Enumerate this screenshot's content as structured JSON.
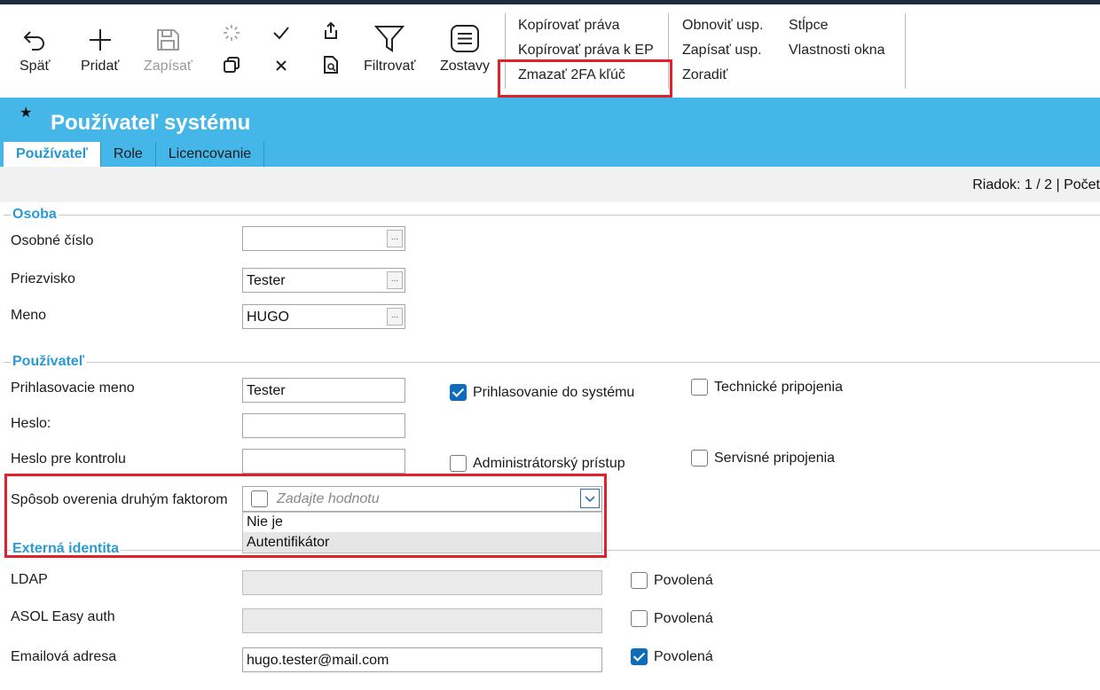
{
  "toolbar": {
    "back_label": "Späť",
    "add_label": "Pridať",
    "save_label": "Zapísať",
    "filter_label": "Filtrovať",
    "reports_label": "Zostavy",
    "menu_col1": [
      "Kopírovať práva",
      "Kopírovať práva k EP",
      "Zmazať 2FA kľúč"
    ],
    "menu_col2": [
      "Obnoviť usp.",
      "Zapísať usp.",
      "Zoradiť"
    ],
    "menu_col3": [
      "Stĺpce",
      "Vlastnosti okna"
    ]
  },
  "page": {
    "title": "Používateľ systému",
    "tabs": [
      "Používateľ",
      "Role",
      "Licencovanie"
    ],
    "status": "Riadok: 1 / 2 | Počet"
  },
  "osoba": {
    "title": "Osoba",
    "personal_number_label": "Osobné číslo",
    "personal_number_value": "",
    "surname_label": "Priezvisko",
    "surname_value": "Tester",
    "name_label": "Meno",
    "name_value": "HUGO"
  },
  "user": {
    "title": "Používateľ",
    "login_label": "Prihlasovacie meno",
    "login_value": "Tester",
    "password_label": "Heslo:",
    "password_check_label": "Heslo pre kontrolu",
    "login_enabled_label": "Prihlasovanie do systému",
    "admin_label": "Administrátorský prístup",
    "tech_conn_label": "Technické pripojenia",
    "service_conn_label": "Servisné pripojenia",
    "twofa_label": "Spôsob overenia druhým faktorom",
    "twofa_placeholder": "Zadajte hodnotu",
    "twofa_options": [
      "Nie je",
      "Autentifikátor"
    ]
  },
  "external": {
    "title": "Externá identita",
    "ldap_label": "LDAP",
    "asol_label": "ASOL Easy auth",
    "email_label": "Emailová adresa",
    "email_value": "hugo.tester@mail.com",
    "enabled_label": "Povolená"
  },
  "colors": {
    "accent": "#45b6e8",
    "highlight_box": "#e0202a",
    "checkbox_checked": "#0f6cbd"
  }
}
